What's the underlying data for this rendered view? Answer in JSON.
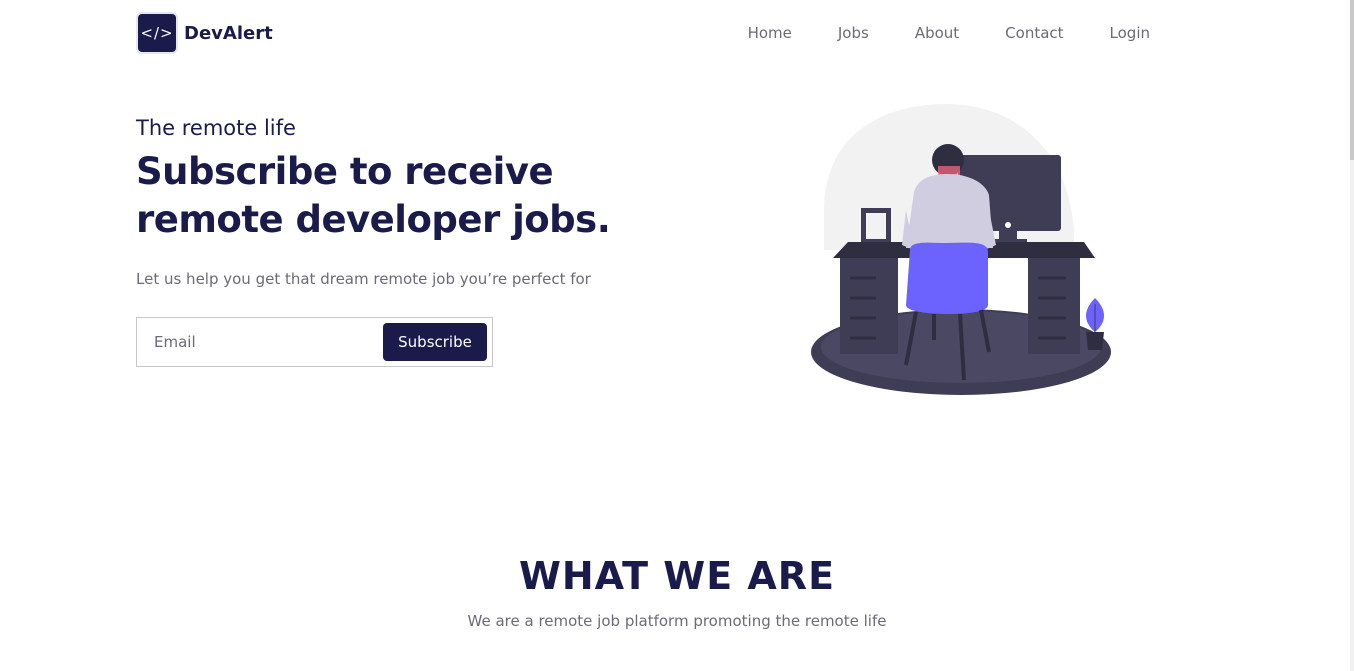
{
  "brand": {
    "logo_text": "</>",
    "name": "DevAlert"
  },
  "nav": {
    "links": [
      {
        "label": "Home"
      },
      {
        "label": "Jobs"
      },
      {
        "label": "About"
      },
      {
        "label": "Contact"
      },
      {
        "label": "Login"
      }
    ]
  },
  "hero": {
    "eyebrow": "The remote life",
    "headline_line1": "Subscribe to receive",
    "headline_line2": "remote developer jobs.",
    "subtext": "Let us help you get that dream remote job you’re perfect for",
    "email_placeholder": "Email",
    "subscribe_label": "Subscribe"
  },
  "section": {
    "title": "WHAT WE ARE",
    "subtitle": "We are a remote job platform promoting the remote life"
  },
  "colors": {
    "primary": "#1a1b4b",
    "muted_text": "#6b6b78",
    "accent": "#6c63ff",
    "illustration_dark": "#3f3d56"
  }
}
